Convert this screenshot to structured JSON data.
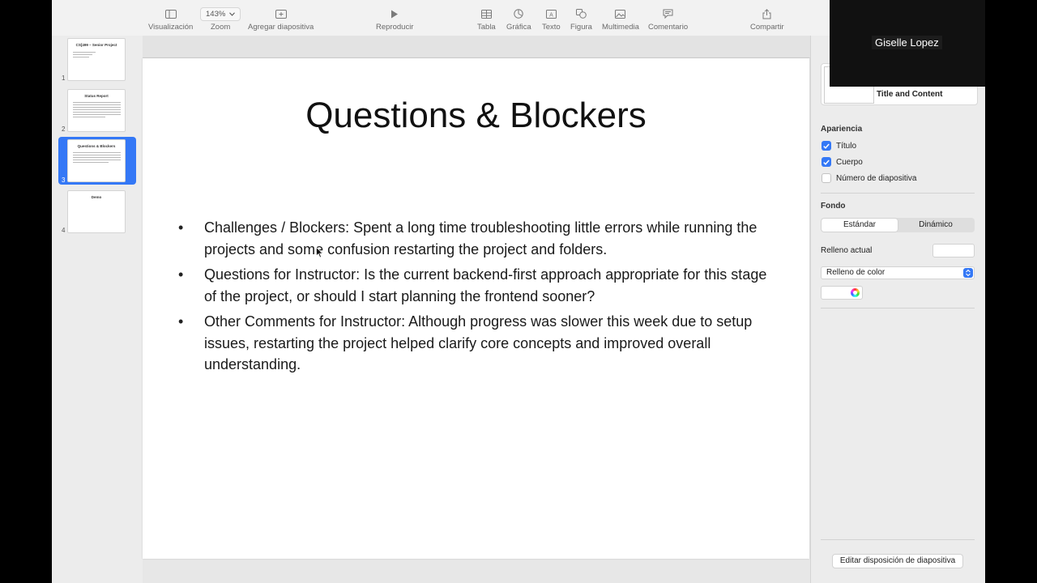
{
  "toolbar": {
    "view_label": "Visualización",
    "zoom_value": "143%",
    "zoom_label": "Zoom",
    "add_slide_label": "Agregar diapositiva",
    "play_label": "Reproducir",
    "table_label": "Tabla",
    "chart_label": "Gráfica",
    "text_label": "Texto",
    "shape_label": "Figura",
    "media_label": "Multimedia",
    "comment_label": "Comentario",
    "share_label": "Compartir"
  },
  "navigator": {
    "slides": [
      {
        "number": "1",
        "title": "CS[499 – Senior Project"
      },
      {
        "number": "2",
        "title": "Status Report"
      },
      {
        "number": "3",
        "title": "Questions & Blockers"
      },
      {
        "number": "4",
        "title": "Demo"
      }
    ],
    "selected_index": 3
  },
  "slide": {
    "title": "Questions & Blockers",
    "bullets": [
      "Challenges / Blockers: Spent a long time troubleshooting little errors while running the projects and some confusion restarting the project and folders.",
      "Questions for Instructor: Is the current backend-first approach appropriate for this stage of the project, or should I start planning the frontend sooner?",
      "Other Comments for Instructor: Although progress was slower this week due to setup issues, restarting the project helped clarify core concepts and improved overall understanding."
    ]
  },
  "inspector": {
    "layout_name": "Title and Content",
    "appearance_label": "Apariencia",
    "title_check_label": "Título",
    "body_check_label": "Cuerpo",
    "slide_number_label": "Número de diapositiva",
    "background_label": "Fondo",
    "tab_standard": "Estándar",
    "tab_dynamic": "Dinámico",
    "current_fill_label": "Relleno actual",
    "fill_type_value": "Relleno de color",
    "edit_layout_button": "Editar disposición de diapositiva"
  },
  "video": {
    "participant_name": "Giselle Lopez"
  },
  "colors": {
    "accent": "#3478f6",
    "app_background": "#ececec",
    "slide_background": "#ffffff"
  }
}
